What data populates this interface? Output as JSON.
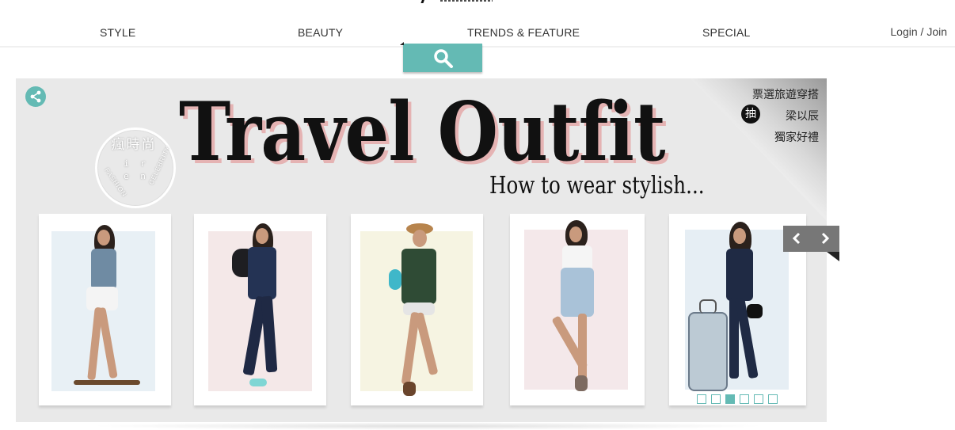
{
  "nav": {
    "items": [
      {
        "label": "STYLE"
      },
      {
        "label": "BEAUTY"
      },
      {
        "label": "TRENDS & FEATURE"
      },
      {
        "label": "SPECIAL"
      }
    ],
    "login": "Login / Join"
  },
  "search": {
    "icon": "search-icon"
  },
  "banner": {
    "title": "Travel Outfit",
    "subtitle": "How to wear stylish...",
    "badge": {
      "title": "瘋時尚",
      "row1": "i r",
      "row2": "e n",
      "ring_left": "FASHION",
      "ring_right": "CELEBRITY"
    },
    "promo": {
      "line1": "票選旅遊穿搭",
      "draw_char": "抽",
      "line2": "梁以辰",
      "line3": "獨家好禮"
    },
    "accent_color": "#64bab4",
    "slides": [
      {
        "name": "outfit-1"
      },
      {
        "name": "outfit-2"
      },
      {
        "name": "outfit-3"
      },
      {
        "name": "outfit-4"
      },
      {
        "name": "outfit-5"
      }
    ],
    "pagination": {
      "count": 6,
      "active_index": 2
    }
  }
}
